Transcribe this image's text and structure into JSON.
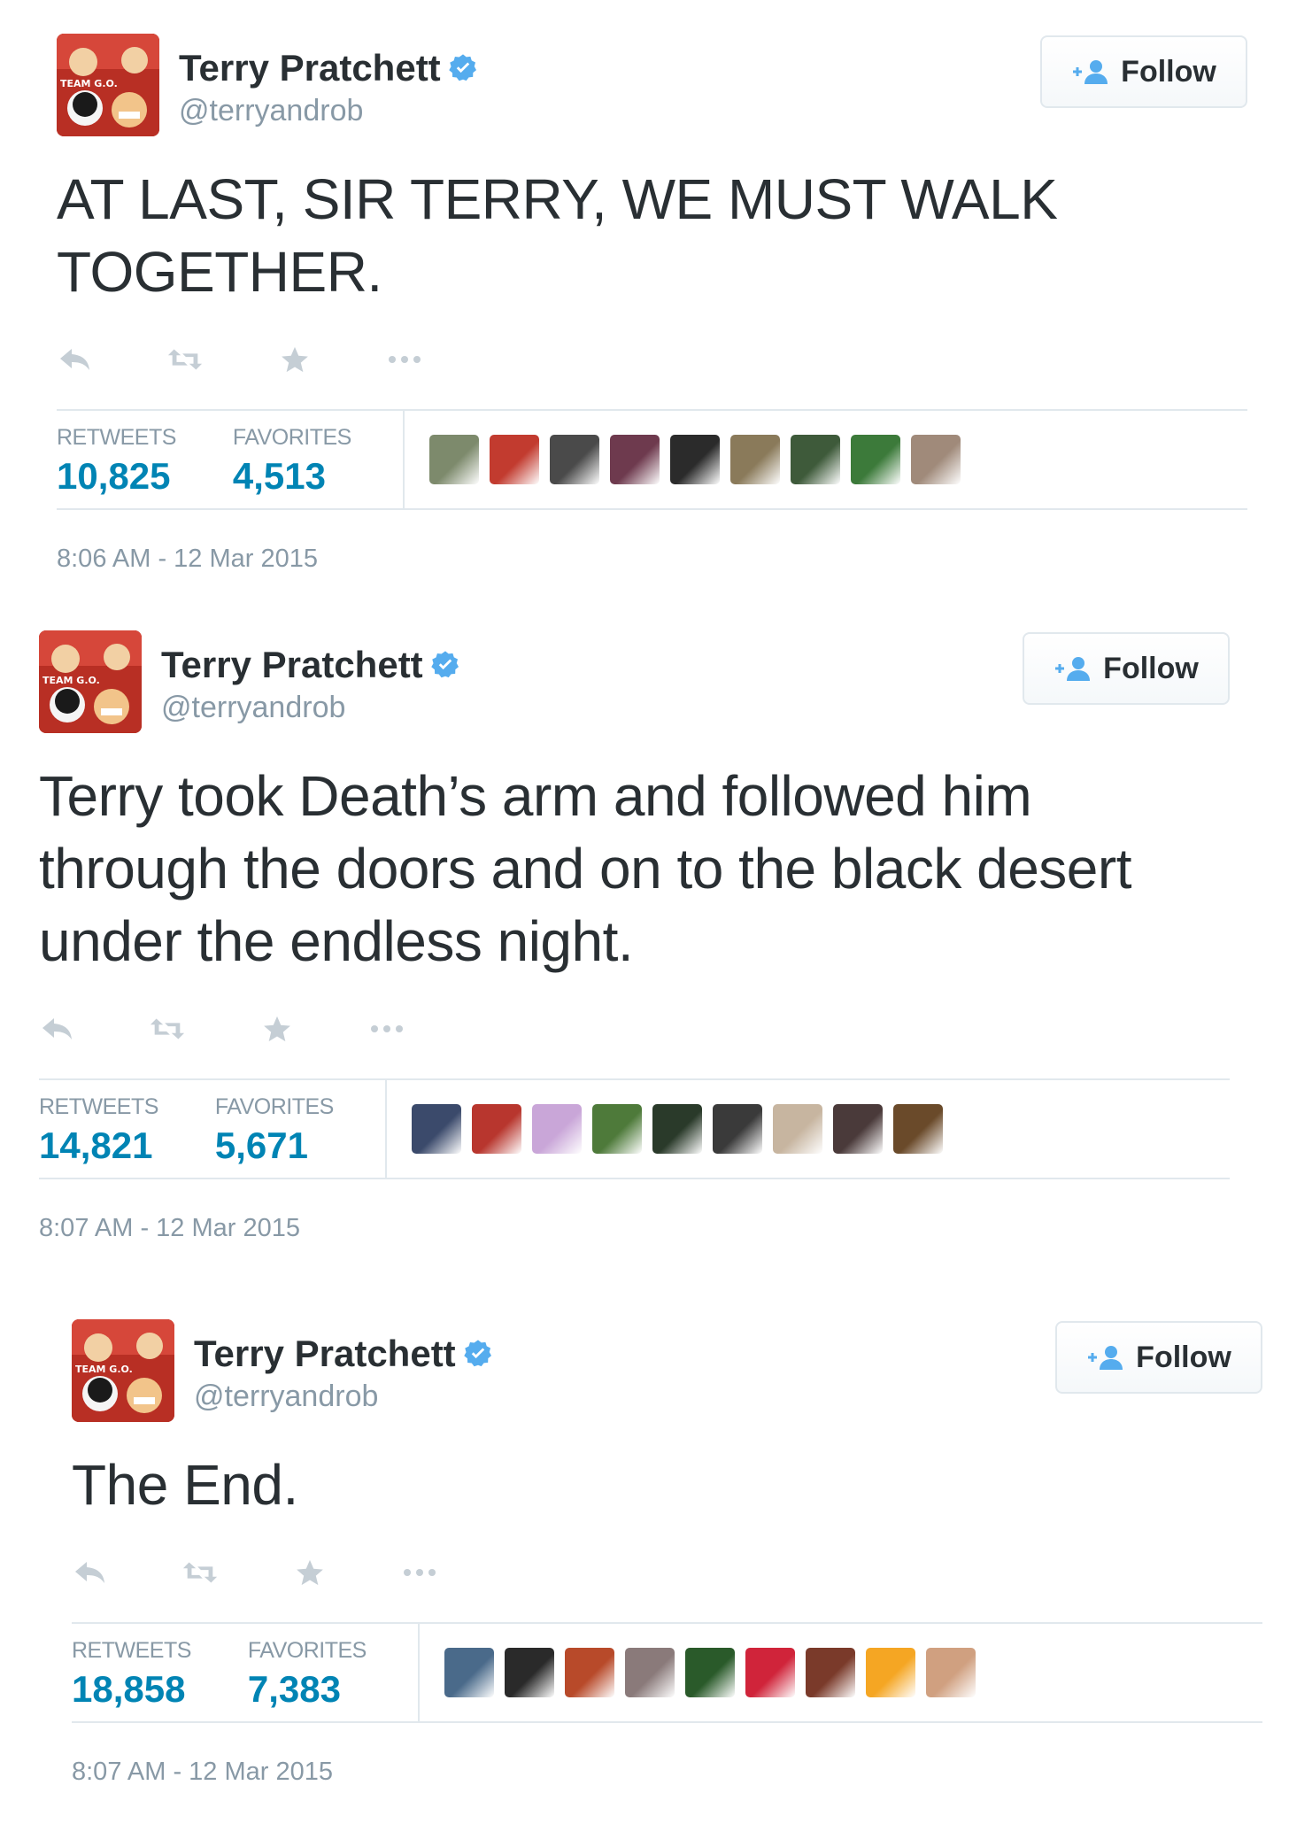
{
  "tweets": [
    {
      "author_name": "Terry Pratchett",
      "author_handle": "@terryandrob",
      "avatar_text": "TEAM G.O.",
      "follow_label": "Follow",
      "text": "AT LAST, SIR TERRY, WE MUST WALK TOGETHER.",
      "retweets_label": "RETWEETS",
      "retweets": "10,825",
      "favorites_label": "FAVORITES",
      "favorites": "4,513",
      "timestamp": "8:06 AM - 12 Mar 2015",
      "favoriter_colors": [
        "#7d8a6c",
        "#c23b2f",
        "#4a4a4a",
        "#6e3a4e",
        "#2b2b2b",
        "#8a7a5a",
        "#3e5a3a",
        "#3c7a3a",
        "#a08a7a"
      ]
    },
    {
      "author_name": "Terry Pratchett",
      "author_handle": "@terryandrob",
      "avatar_text": "TEAM G.O.",
      "follow_label": "Follow",
      "text": "Terry took Death’s arm and followed him through the doors and on to the black desert under the endless night.",
      "retweets_label": "RETWEETS",
      "retweets": "14,821",
      "favorites_label": "FAVORITES",
      "favorites": "5,671",
      "timestamp": "8:07 AM - 12 Mar 2015",
      "favoriter_colors": [
        "#3b4a6b",
        "#b8362e",
        "#c9a6d8",
        "#4e7a3a",
        "#2a3a2a",
        "#3a3a3a",
        "#c7b5a0",
        "#4a3a3a",
        "#6a4a2a"
      ]
    },
    {
      "author_name": "Terry Pratchett",
      "author_handle": "@terryandrob",
      "avatar_text": "TEAM G.O.",
      "follow_label": "Follow",
      "text": "The End.",
      "retweets_label": "RETWEETS",
      "retweets": "18,858",
      "favorites_label": "FAVORITES",
      "favorites": "7,383",
      "timestamp": "8:07 AM - 12 Mar 2015",
      "favoriter_colors": [
        "#4a6a8a",
        "#2a2a2a",
        "#b84a2a",
        "#8a7a7a",
        "#2a5a2a",
        "#d0243a",
        "#7a3a2a",
        "#f5a623",
        "#d0a080"
      ]
    }
  ],
  "colors": {
    "link": "#0084b4",
    "muted": "#8899a6",
    "text": "#292f33",
    "border": "#e1e8ed",
    "verified": "#55acee",
    "follow_icon": "#55acee"
  },
  "icons": {
    "actions": [
      "reply-icon",
      "retweet-icon",
      "favorite-icon",
      "more-icon"
    ],
    "follow": "add-user-icon",
    "verified": "verified-badge-icon"
  }
}
